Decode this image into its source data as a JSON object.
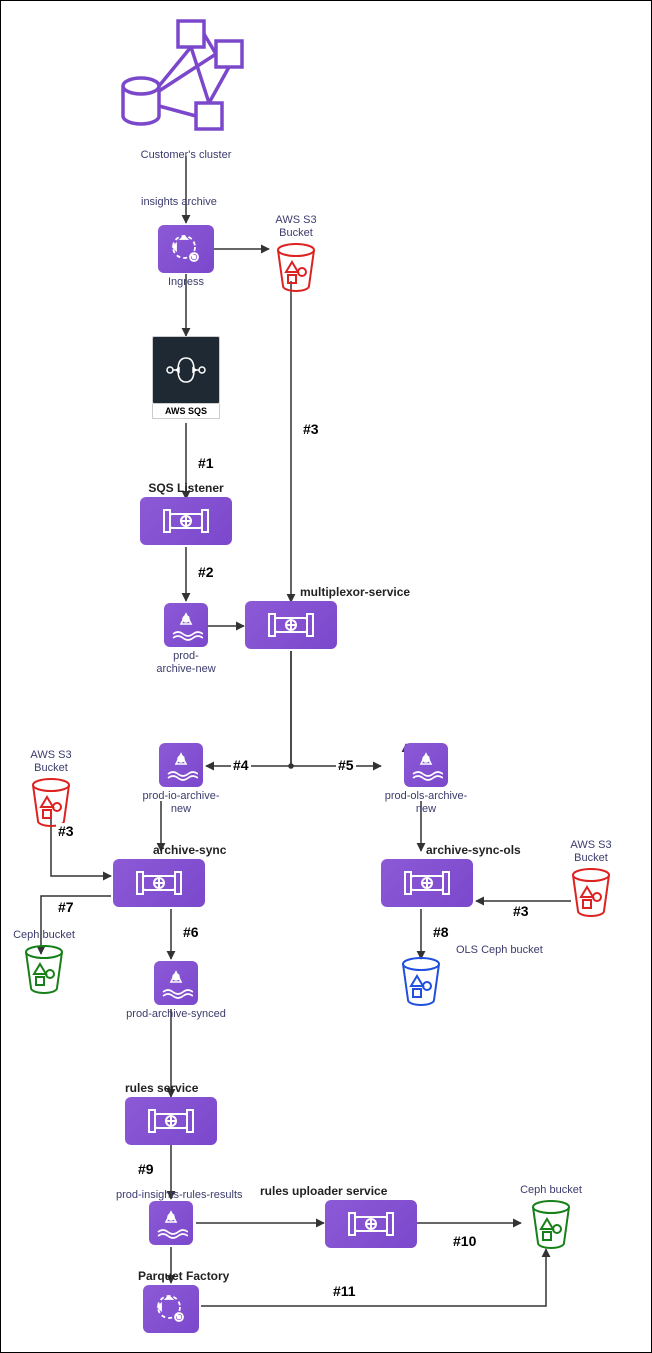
{
  "diagram": {
    "nodes": {
      "cluster": {
        "label": "Customer's cluster"
      },
      "ingress": {
        "label": "Ingress"
      },
      "s3_top": {
        "label": "AWS S3 Bucket"
      },
      "sqs": {
        "label": "AWS SQS"
      },
      "sqs_listener_title": "SQS Listener",
      "prod_archive_new": {
        "label": "prod-\narchive-new"
      },
      "multiplexor_title": "multiplexor-service",
      "prod_io_archive_new": {
        "label": "prod-io-archive-new"
      },
      "prod_ols_archive_new": {
        "label": "prod-ols-archive-new"
      },
      "s3_left": {
        "label": "AWS S3 Bucket"
      },
      "s3_right": {
        "label": "AWS S3 Bucket"
      },
      "archive_sync_title": "archive-sync",
      "archive_sync_ols_title": "archive-sync-ols",
      "ceph_left": {
        "label": "Ceph bucket"
      },
      "ols_ceph": {
        "label": "OLS Ceph bucket"
      },
      "prod_archive_synced": {
        "label": "prod-archive-synced"
      },
      "rules_service_title": "rules service",
      "prod_insights_rules_results": {
        "label": "prod-insights-rules-results"
      },
      "rules_uploader_title": "rules uploader service",
      "ceph_right": {
        "label": "Ceph bucket"
      },
      "parquet_title": "Parquet Factory"
    },
    "edges": {
      "insights_archive": "insights archive",
      "e1": "#1",
      "e2": "#2",
      "e3a": "#3",
      "e3b": "#3",
      "e3c": "#3",
      "e4": "#4",
      "e5": "#5",
      "e6": "#6",
      "e7": "#7",
      "e8": "#8",
      "e9": "#9",
      "e10": "#10",
      "e11": "#11"
    }
  }
}
